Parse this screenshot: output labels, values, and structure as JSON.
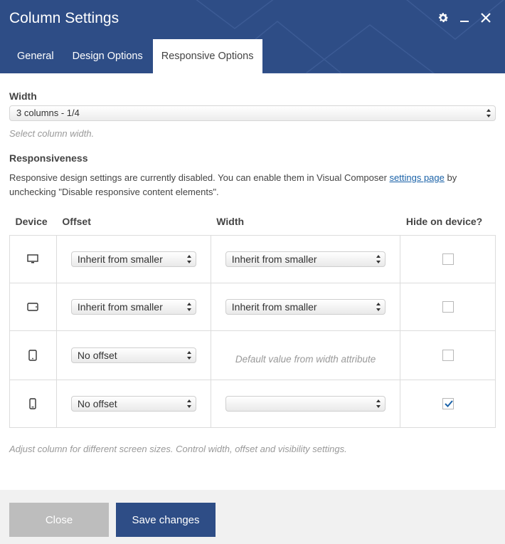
{
  "window": {
    "title": "Column Settings"
  },
  "tabs": [
    {
      "label": "General"
    },
    {
      "label": "Design Options"
    },
    {
      "label": "Responsive Options"
    }
  ],
  "width_field": {
    "label": "Width",
    "value": "3 columns - 1/4",
    "hint": "Select column width."
  },
  "responsiveness": {
    "label": "Responsiveness",
    "desc_before": "Responsive design settings are currently disabled. You can enable them in Visual Composer ",
    "link_text": "settings page",
    "desc_after": " by unchecking \"Disable responsive content elements\"."
  },
  "table": {
    "headers": {
      "device": "Device",
      "offset": "Offset",
      "width": "Width",
      "hide": "Hide on device?"
    },
    "rows": [
      {
        "device_icon": "desktop-icon",
        "offset": "Inherit from smaller",
        "width": "Inherit from smaller",
        "width_text": "",
        "hidden": false
      },
      {
        "device_icon": "tablet-landscape-icon",
        "offset": "Inherit from smaller",
        "width": "Inherit from smaller",
        "width_text": "",
        "hidden": false
      },
      {
        "device_icon": "tablet-portrait-icon",
        "offset": "No offset",
        "width": "",
        "width_text": "Default value from width attribute",
        "hidden": false
      },
      {
        "device_icon": "phone-icon",
        "offset": "No offset",
        "width": "",
        "width_text": "",
        "hidden": true
      }
    ],
    "footer_hint": "Adjust column for different screen sizes. Control width, offset and visibility settings."
  },
  "buttons": {
    "close": "Close",
    "save": "Save changes"
  },
  "colors": {
    "header_bg": "#2e4d86",
    "save_bg": "#2e4d86",
    "close_bg": "#bdbdbd",
    "checkmark": "#1a62a8"
  },
  "icons": {
    "settings": "gear-icon",
    "minimize": "minimize-icon",
    "close": "close-icon"
  }
}
